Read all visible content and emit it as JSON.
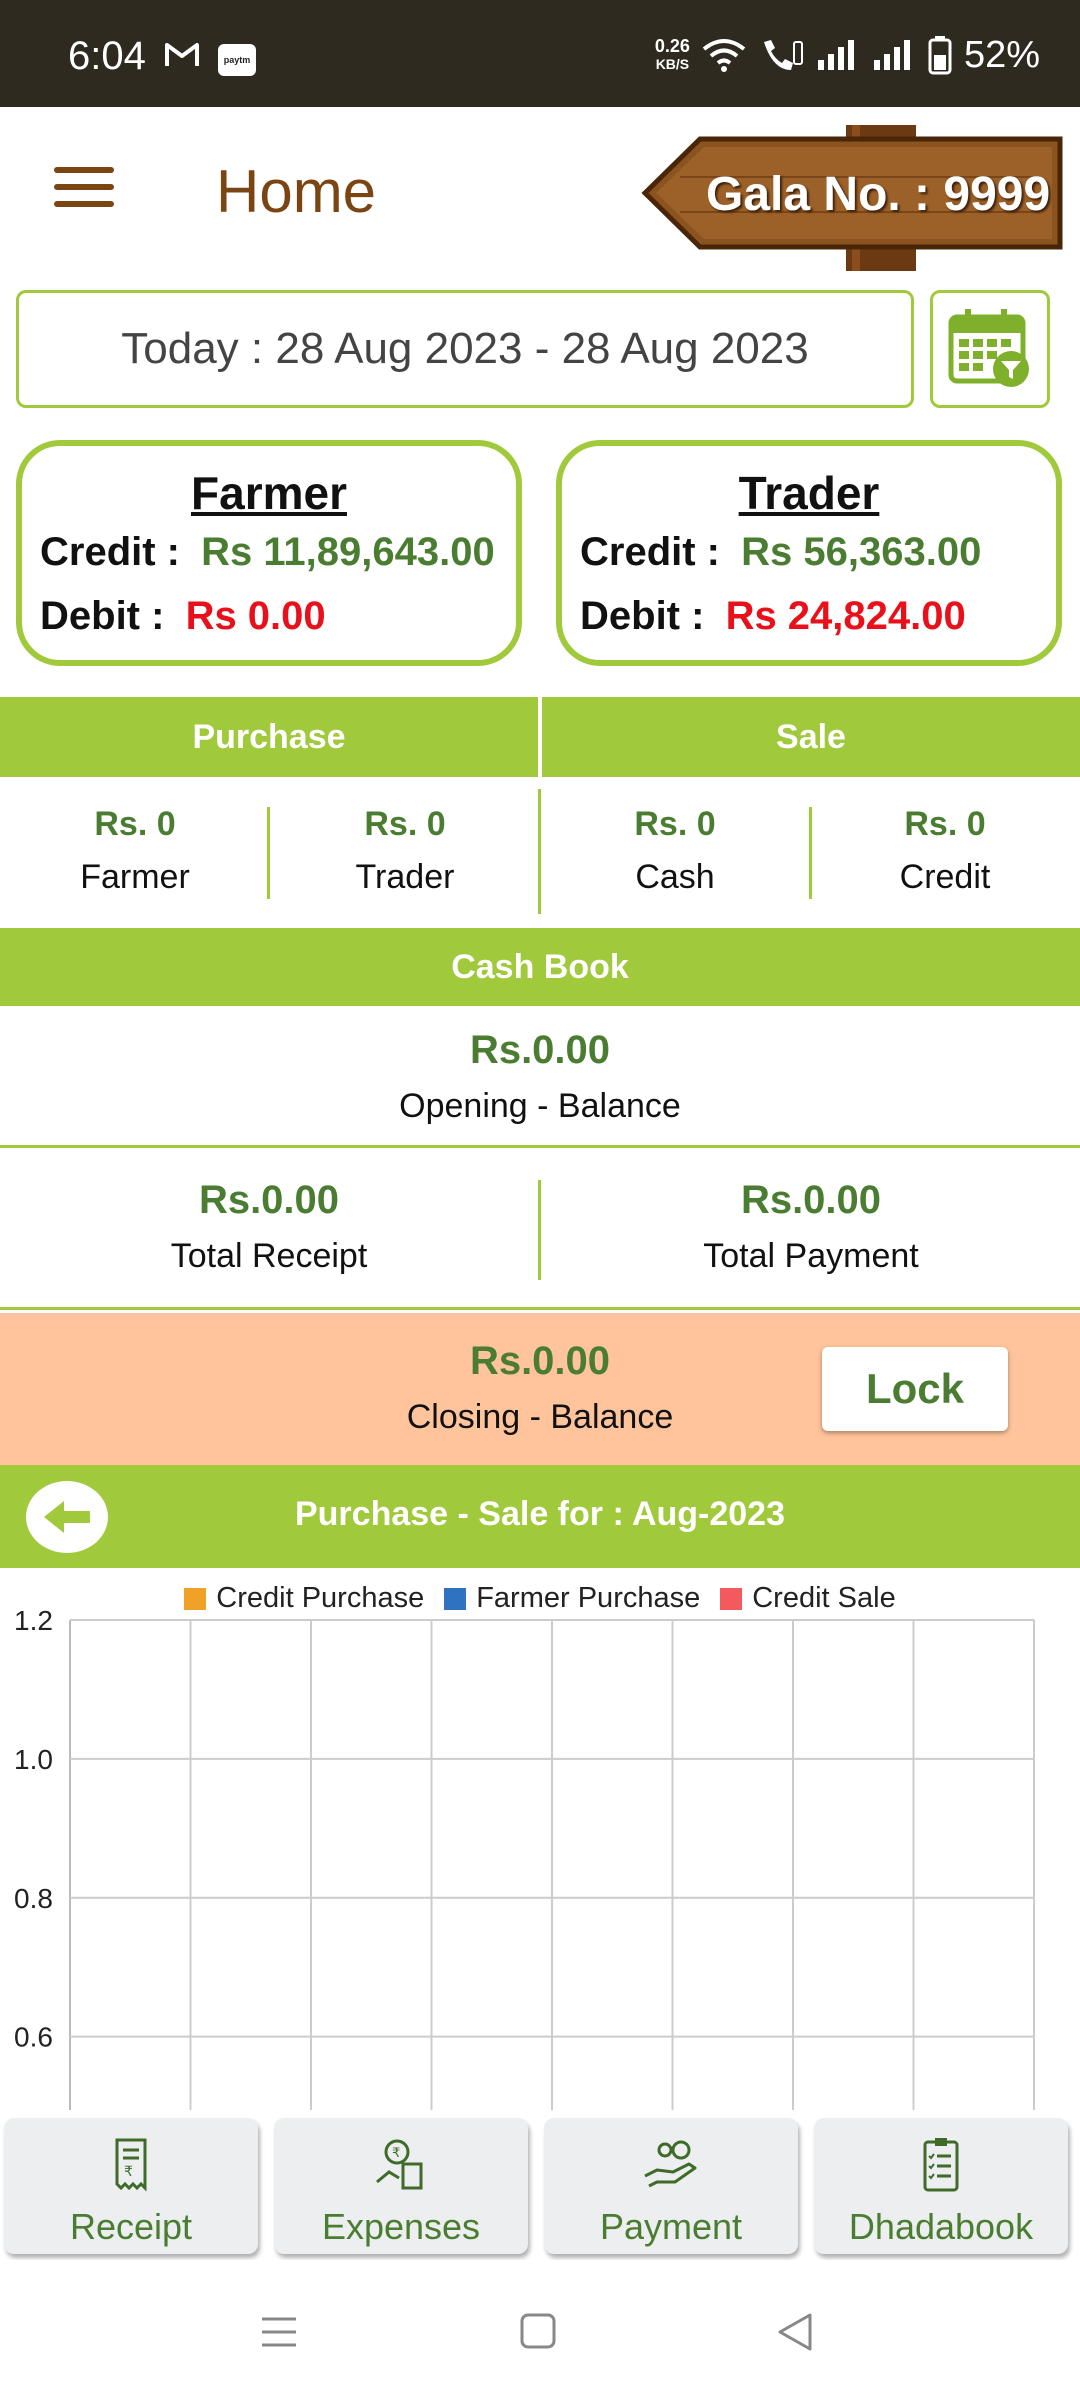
{
  "status_bar": {
    "time": "6:04",
    "net_speed_value": "0.26",
    "net_speed_unit": "KB/S",
    "battery": "52%"
  },
  "app_bar": {
    "title": "Home",
    "gala_label": "Gala No. : 9999"
  },
  "date_filter": {
    "label": "Today : 28 Aug 2023 - 28 Aug 2023"
  },
  "cards": {
    "farmer": {
      "title": "Farmer",
      "credit_label": "Credit :",
      "credit_value": "Rs 11,89,643.00",
      "debit_label": "Debit :",
      "debit_value": "Rs 0.00"
    },
    "trader": {
      "title": "Trader",
      "credit_label": "Credit :",
      "credit_value": "Rs 56,363.00",
      "debit_label": "Debit :",
      "debit_value": "Rs 24,824.00"
    }
  },
  "purchase_sale": {
    "purchase_header": "Purchase",
    "sale_header": "Sale",
    "cells": [
      {
        "value": "Rs. 0",
        "label": "Farmer"
      },
      {
        "value": "Rs. 0",
        "label": "Trader"
      },
      {
        "value": "Rs. 0",
        "label": "Cash"
      },
      {
        "value": "Rs. 0",
        "label": "Credit"
      }
    ]
  },
  "cash_book": {
    "header": "Cash Book",
    "opening_value": "Rs.0.00",
    "opening_label": "Opening - Balance",
    "receipt_value": "Rs.0.00",
    "receipt_label": "Total Receipt",
    "payment_value": "Rs.0.00",
    "payment_label": "Total Payment",
    "closing_value": "Rs.0.00",
    "closing_label": "Closing - Balance",
    "lock_label": "Lock"
  },
  "chart_section": {
    "title": "Purchase - Sale for :  Aug-2023"
  },
  "chart_data": {
    "type": "bar",
    "categories": [],
    "series": [
      {
        "name": "Credit Purchase",
        "values": [],
        "color": "#f0a128"
      },
      {
        "name": "Farmer Purchase",
        "values": [],
        "color": "#2f73c0"
      },
      {
        "name": "Credit Sale",
        "values": [],
        "color": "#f25a5e"
      }
    ],
    "y_ticks": [
      "1.2",
      "1.0",
      "0.8",
      "0.6"
    ],
    "y_tick_values": [
      1.2,
      1.0,
      0.8,
      0.6
    ],
    "ylim": [
      0.48,
      1.2
    ],
    "grid": true,
    "vertical_gridlines": 8,
    "legend_position": "top-center"
  },
  "bottom_nav": {
    "items": [
      {
        "label": "Receipt",
        "icon": "receipt-icon"
      },
      {
        "label": "Expenses",
        "icon": "expenses-icon"
      },
      {
        "label": "Payment",
        "icon": "payment-icon"
      },
      {
        "label": "Dhadabook",
        "icon": "clipboard-icon"
      }
    ]
  }
}
